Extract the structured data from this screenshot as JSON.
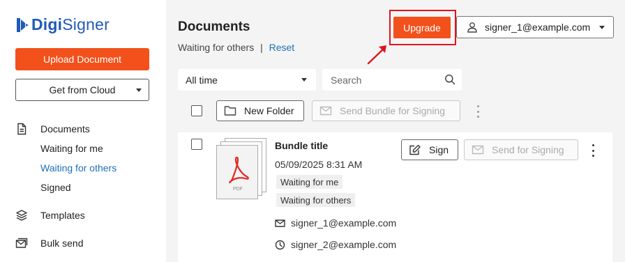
{
  "brand": {
    "name_bold": "Digi",
    "name_rest": "Signer",
    "color": "#1f5bb8"
  },
  "accent": "#f2511b",
  "sidebar": {
    "upload_label": "Upload Document",
    "cloud_label": "Get from Cloud",
    "nav": {
      "documents": {
        "label": "Documents",
        "icon": "document-icon"
      },
      "sub": [
        {
          "label": "Waiting for me",
          "active": false
        },
        {
          "label": "Waiting for others",
          "active": true
        },
        {
          "label": "Signed",
          "active": false
        }
      ],
      "templates": {
        "label": "Templates",
        "icon": "layers-icon"
      },
      "bulk": {
        "label": "Bulk send",
        "icon": "bulk-send-icon"
      }
    }
  },
  "header": {
    "title": "Documents",
    "filter_text": "Waiting for others",
    "separator": "|",
    "reset_label": "Reset",
    "upgrade_label": "Upgrade",
    "user_email": "signer_1@example.com"
  },
  "filters": {
    "time_value": "All time",
    "search_placeholder": "Search"
  },
  "toolbar": {
    "new_folder_label": "New Folder",
    "send_bundle_label": "Send Bundle for Signing"
  },
  "document": {
    "thumbnail_label": "PDF",
    "title": "Bundle title",
    "date": "05/09/2025 8:31 AM",
    "badges": [
      "Waiting for me",
      "Waiting for others"
    ],
    "sign_label": "Sign",
    "send_label": "Send for Signing",
    "signers": [
      {
        "email": "signer_1@example.com",
        "icon": "envelope-icon"
      },
      {
        "email": "signer_2@example.com",
        "icon": "clock-icon"
      }
    ]
  }
}
